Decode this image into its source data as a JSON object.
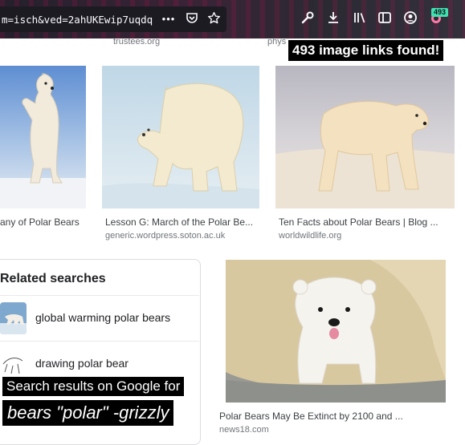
{
  "browser": {
    "url": "m=isch&ved=2ahUKEwip7uqdq",
    "menu_glyph": "•••",
    "extension_badge": "493"
  },
  "sources_top": [
    "trustees.org",
    "phys"
  ],
  "results": [
    {
      "caption": "any of Polar Bears",
      "domain": ""
    },
    {
      "caption": "Lesson G: March of the Polar Be...",
      "domain": "generic.wordpress.soton.ac.uk"
    },
    {
      "caption": "Ten Facts about Polar Bears | Blog ...",
      "domain": "worldwildlife.org"
    },
    {
      "caption": "Polar Bears May Be Extinct by 2100 and ...",
      "domain": "news18.com"
    }
  ],
  "related": {
    "title": "Related searches",
    "items": [
      {
        "label": "global warming polar bears"
      },
      {
        "label": "drawing polar bear"
      }
    ]
  },
  "overlays": {
    "found": "493 image links found!",
    "google": "Search results on Google for",
    "query": "bears \"polar\" -grizzly"
  },
  "colors": {
    "toolbar": "#2b2a33",
    "urlbar": "#1c1b22",
    "badge": "#3fe1b0",
    "caption_text": "#3c4043",
    "domain_text": "#70757a"
  }
}
